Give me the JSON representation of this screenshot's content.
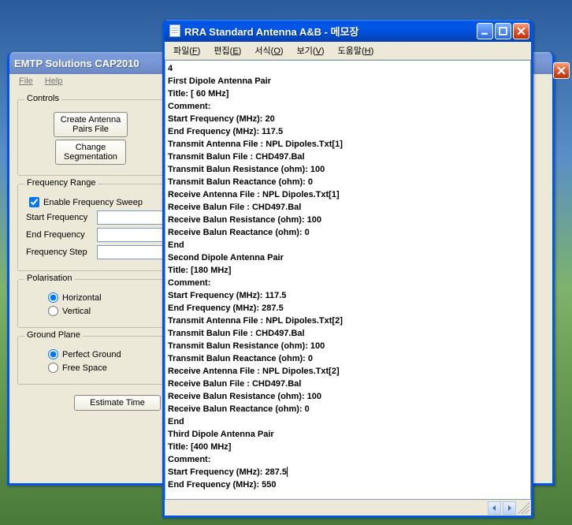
{
  "app": {
    "title": "EMTP Solutions CAP2010",
    "menu": {
      "file": "File",
      "help": "Help"
    },
    "controls": {
      "legend": "Controls",
      "create_btn_l1": "Create Antenna",
      "create_btn_l2": "Pairs File",
      "change_btn_l1": "Change",
      "change_btn_l2": "Segmentation"
    },
    "freq": {
      "legend": "Frequency Range",
      "enable_label": "Enable Frequency Sweep",
      "start_label": "Start Frequency",
      "end_label": "End Frequency",
      "step_label": "Frequency Step",
      "start_val": "",
      "end_val": "",
      "step_val": ""
    },
    "pol": {
      "legend": "Polarisation",
      "horiz": "Horizontal",
      "vert": "Vertical"
    },
    "ground": {
      "legend": "Ground Plane",
      "perfect": "Perfect Ground",
      "free": "Free Space"
    },
    "estimate_btn": "Estimate Time"
  },
  "notepad": {
    "title": "RRA Standard Antenna A&B - 메모장",
    "menu": {
      "file": "파일",
      "file_u": "F",
      "edit": "편집",
      "edit_u": "E",
      "format": "서식",
      "format_u": "O",
      "view": "보기",
      "view_u": "V",
      "help": "도움말",
      "help_u": "H"
    },
    "content": "4\nFirst Dipole Antenna Pair\nTitle: [ 60 MHz]\nComment:\nStart Frequency (MHz): 20\nEnd Frequency (MHz): 117.5\nTransmit Antenna File : NPL Dipoles.Txt[1]\nTransmit Balun File : CHD497.Bal\nTransmit Balun Resistance (ohm): 100\nTransmit Balun Reactance (ohm): 0\nReceive Antenna File : NPL Dipoles.Txt[1]\nReceive Balun File : CHD497.Bal\nReceive Balun Resistance (ohm): 100\nReceive Balun Reactance (ohm): 0\nEnd\nSecond Dipole Antenna Pair\nTitle: [180 MHz]\nComment:\nStart Frequency (MHz): 117.5\nEnd Frequency (MHz): 287.5\nTransmit Antenna File : NPL Dipoles.Txt[2]\nTransmit Balun File : CHD497.Bal\nTransmit Balun Resistance (ohm): 100\nTransmit Balun Reactance (ohm): 0\nReceive Antenna File : NPL Dipoles.Txt[2]\nReceive Balun File : CHD497.Bal\nReceive Balun Resistance (ohm): 100\nReceive Balun Reactance (ohm): 0\nEnd\nThird Dipole Antenna Pair\nTitle: [400 MHz]\nComment:\nStart Frequency (MHz): 287.5",
    "content_tail": "\nEnd Frequency (MHz): 550\n"
  }
}
